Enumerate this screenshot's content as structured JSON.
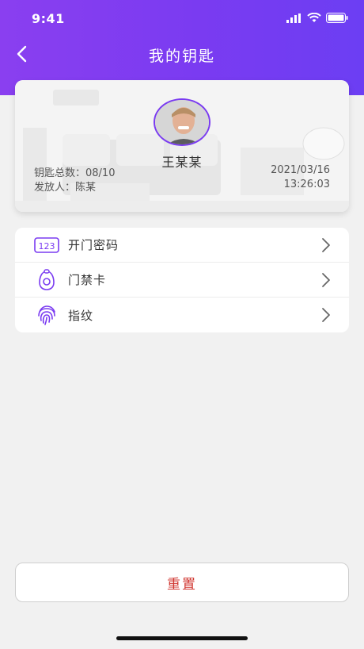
{
  "status_bar": {
    "time": "9:41",
    "icons": [
      "signal-icon",
      "wifi-icon",
      "battery-icon"
    ]
  },
  "nav": {
    "title": "我的钥匙",
    "back_icon": "back-chevron-icon"
  },
  "key_card": {
    "holder_name": "王某某",
    "key_count_text": "钥匙总数：08/10",
    "issuer_text": "发放人：陈某",
    "date": "2021/03/16",
    "time": "13:26:03"
  },
  "menu": {
    "items": [
      {
        "label": "开门密码",
        "icon": "passcode-123-icon"
      },
      {
        "label": "门禁卡",
        "icon": "access-card-icon"
      },
      {
        "label": "指纹",
        "icon": "fingerprint-icon"
      }
    ]
  },
  "actions": {
    "reset_label": "重置"
  },
  "colors": {
    "header_gradient_start": "#8a3ff0",
    "header_gradient_end": "#6c3ef3",
    "accent_purple": "#7a3bf1",
    "reset_text": "#d0352f",
    "page_bg": "#f1f1f1"
  }
}
